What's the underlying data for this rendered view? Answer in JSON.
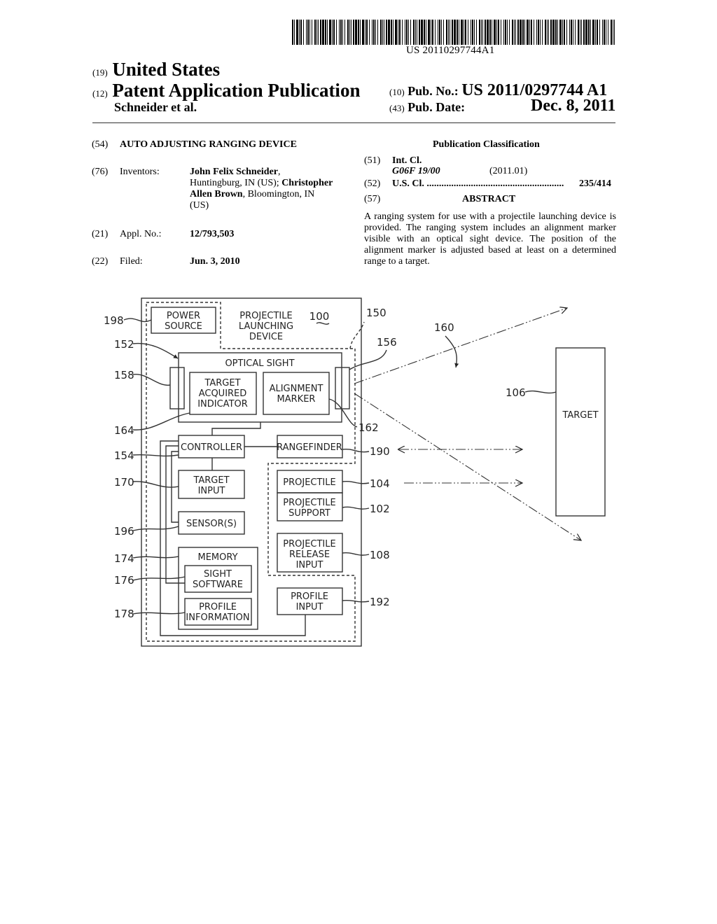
{
  "header": {
    "barcode_number": "US 20110297744A1",
    "country_code": "(19)",
    "country": "United States",
    "type_code": "(12)",
    "type": "Patent Application Publication",
    "authors": "Schneider et al.",
    "pub_no_code": "(10)",
    "pub_no_label": "Pub. No.:",
    "pub_no_value": "US 2011/0297744 A1",
    "pub_date_code": "(43)",
    "pub_date_label": "Pub. Date:",
    "pub_date_value": "Dec. 8, 2011"
  },
  "left_column": {
    "title_code": "(54)",
    "title": "AUTO ADJUSTING RANGING DEVICE",
    "inventors_code": "(76)",
    "inventors_label": "Inventors:",
    "inventor1_name": "John Felix Schneider",
    "inventor1_loc": "Huntingburg, IN (US);",
    "inventor2_name_a": "Christopher",
    "inventor2_name_b": "Allen Brown",
    "inventor2_loc": ", Bloomington, IN",
    "inventor2_country": "(US)",
    "appl_code": "(21)",
    "appl_label": "Appl. No.:",
    "appl_value": "12/793,503",
    "filed_code": "(22)",
    "filed_label": "Filed:",
    "filed_value": "Jun. 3, 2010"
  },
  "right_column": {
    "classification_heading": "Publication Classification",
    "int_cl_code": "(51)",
    "int_cl_label": "Int. Cl.",
    "int_cl_class": "G06F 19/00",
    "int_cl_year": "(2011.01)",
    "us_cl_code": "(52)",
    "us_cl_label": "U.S. Cl. ........................................................",
    "us_cl_value": "235/414",
    "abstract_code": "(57)",
    "abstract_heading": "ABSTRACT",
    "abstract_text": "A ranging system for use with a projectile launching device is provided. The ranging system includes an alignment marker visible with an optical sight device. The position of the alignment marker is adjusted based at least on a determined range to a target."
  },
  "figure": {
    "device_label": [
      "PROJECTILE",
      "LAUNCHING",
      "DEVICE"
    ],
    "device_ref": "100",
    "blocks": {
      "power_source": [
        "POWER",
        "SOURCE"
      ],
      "optical_sight": "OPTICAL SIGHT",
      "target_acquired": [
        "TARGET",
        "ACQUIRED",
        "INDICATOR"
      ],
      "alignment_marker": [
        "ALIGNMENT",
        "MARKER"
      ],
      "controller": "CONTROLLER",
      "rangefinder": "RANGEFINDER",
      "target_input": [
        "TARGET",
        "INPUT"
      ],
      "sensors": "SENSOR(S)",
      "memory": "MEMORY",
      "sight_software": [
        "SIGHT",
        "SOFTWARE"
      ],
      "profile_information": [
        "PROFILE",
        "INFORMATION"
      ],
      "projectile": "PROJECTILE",
      "projectile_support": [
        "PROJECTILE",
        "SUPPORT"
      ],
      "projectile_release": [
        "PROJECTILE",
        "RELEASE",
        "INPUT"
      ],
      "profile_input": [
        "PROFILE",
        "INPUT"
      ],
      "target": "TARGET"
    },
    "refs": {
      "r198": "198",
      "r152": "152",
      "r158": "158",
      "r164": "164",
      "r154": "154",
      "r170": "170",
      "r196": "196",
      "r174": "174",
      "r176": "176",
      "r178": "178",
      "r150": "150",
      "r156": "156",
      "r160": "160",
      "r162": "162",
      "r190": "190",
      "r104": "104",
      "r102": "102",
      "r108": "108",
      "r192": "192",
      "r106": "106"
    }
  }
}
